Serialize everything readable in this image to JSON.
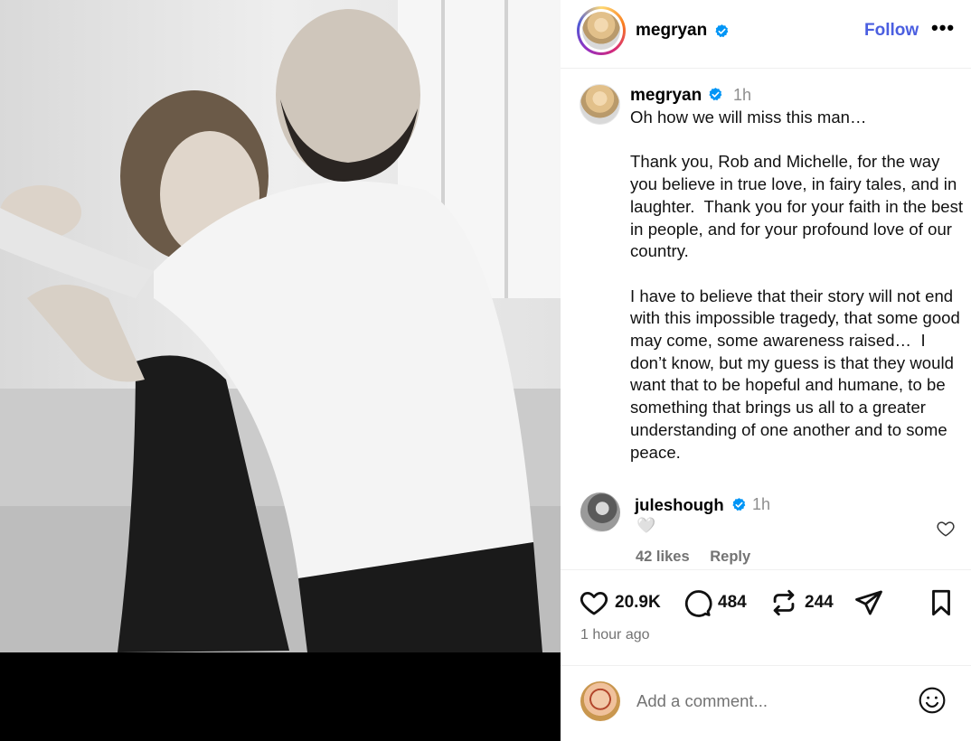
{
  "post": {
    "username": "megryan",
    "follow_label": "Follow",
    "more_label": "•••",
    "caption_time": "1h",
    "caption": "Oh how we will miss this man…\n\nThank you, Rob and Michelle, for the way you believe in true love, in fairy tales, and in laughter.  Thank you for your faith in the best in people, and for your profound love of our country.\n\nI have to believe that their story will not end with this impossible tragedy, that some good may come, some awareness raised…  I don’t know, but my guess is that they would want that to be hopeful and humane, to be something that brings us all to a greater understanding of one another and to some peace."
  },
  "comment": {
    "username": "juleshough",
    "time": "1h",
    "text": "🤍",
    "likes": "42 likes",
    "reply_label": "Reply"
  },
  "actions": {
    "like_count": "20.9K",
    "comment_count": "484",
    "repost_count": "244",
    "timestamp": "1 hour ago"
  },
  "add_comment": {
    "placeholder": "Add a comment..."
  },
  "icons": {
    "verified": "verified-badge-icon",
    "like": "heart-icon",
    "comment": "comment-bubble-icon",
    "repost": "repost-icon",
    "share": "share-send-icon",
    "save": "bookmark-icon",
    "emoji": "smiley-icon"
  },
  "colors": {
    "follow": "#4a5ee0",
    "verified": "#0095f6",
    "secondary_text": "#737373"
  }
}
